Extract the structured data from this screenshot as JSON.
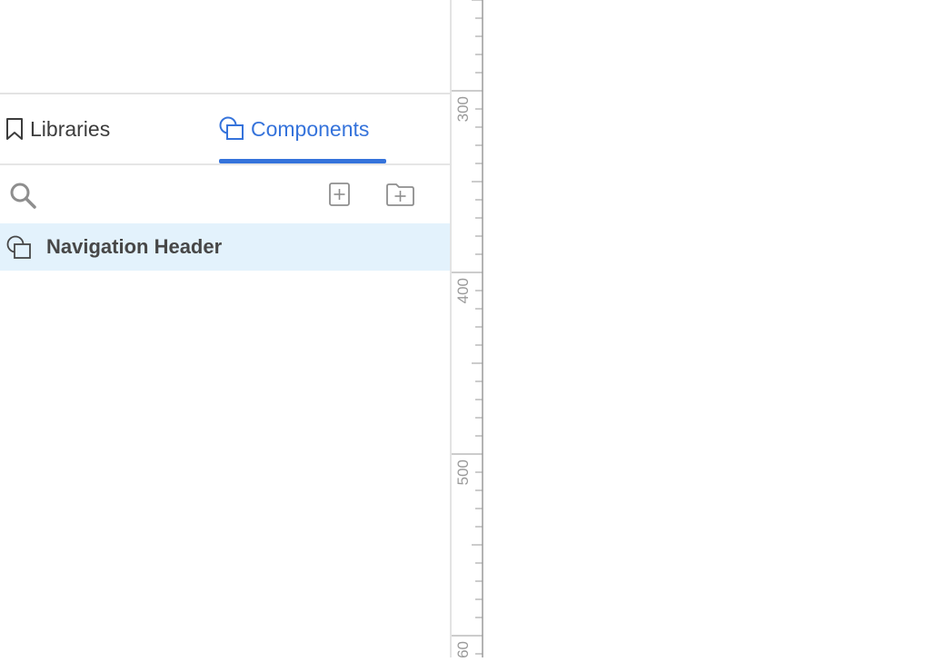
{
  "tabs": {
    "libraries_label": "Libraries",
    "components_label": "Components",
    "active": "components"
  },
  "components": [
    {
      "name": "Navigation Header",
      "selected": true
    }
  ],
  "ruler": {
    "labels": [
      "300",
      "400",
      "500",
      "60"
    ]
  },
  "colors": {
    "accent": "#3573db",
    "selected_row": "#e3f2fc",
    "text": "#474747",
    "ruler_line": "#9a9a9a"
  },
  "icons": {
    "libraries": "bookmark-icon",
    "components": "component-icon",
    "search": "search-icon",
    "add": "add-component-icon",
    "add_folder": "add-folder-icon"
  }
}
